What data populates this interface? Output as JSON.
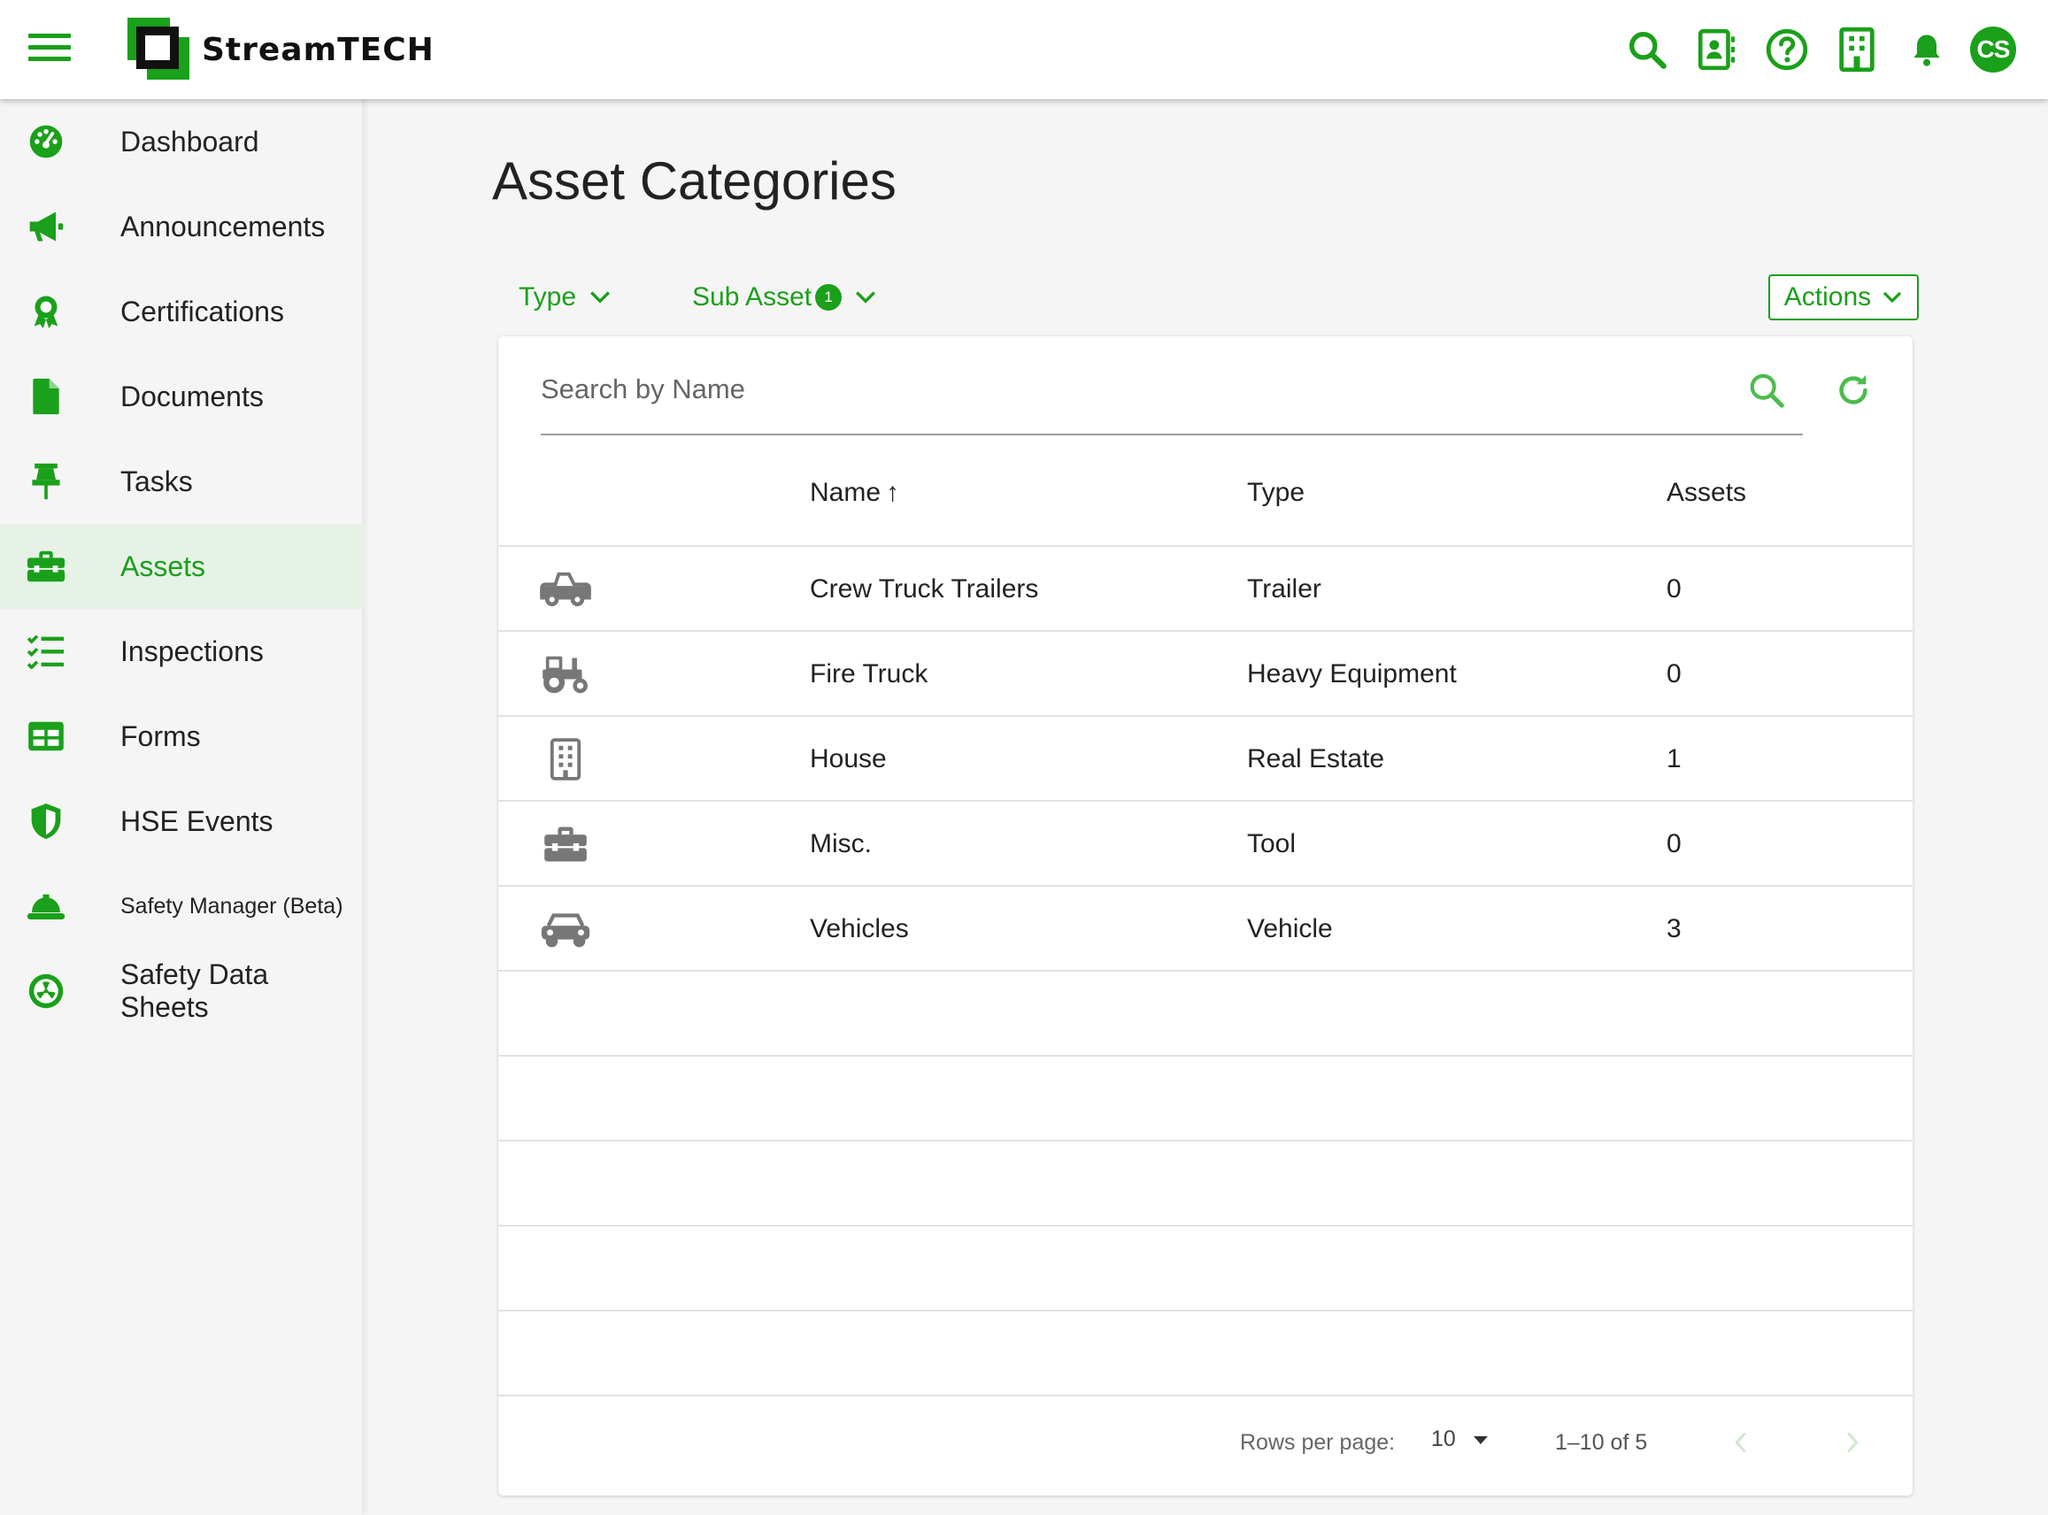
{
  "app": {
    "brand": "StreamTECH",
    "brand_color": "#1aa01a",
    "avatar_initials": "CS"
  },
  "header_icons": [
    "search-icon",
    "contact-card-icon",
    "help-icon",
    "building-icon",
    "bell-icon"
  ],
  "sidebar": {
    "active": "Assets",
    "items": [
      {
        "label": "Dashboard",
        "icon": "dashboard-icon"
      },
      {
        "label": "Announcements",
        "icon": "megaphone-icon"
      },
      {
        "label": "Certifications",
        "icon": "award-icon"
      },
      {
        "label": "Documents",
        "icon": "document-icon"
      },
      {
        "label": "Tasks",
        "icon": "pushpin-icon"
      },
      {
        "label": "Assets",
        "icon": "toolbox-icon"
      },
      {
        "label": "Inspections",
        "icon": "checklist-icon"
      },
      {
        "label": "Forms",
        "icon": "table-icon"
      },
      {
        "label": "HSE Events",
        "icon": "shield-icon"
      },
      {
        "label": "Safety Manager (Beta)",
        "icon": "hardhat-icon"
      },
      {
        "label": "Safety Data Sheets",
        "icon": "hazard-icon"
      }
    ]
  },
  "main": {
    "title": "Asset Categories",
    "filters": {
      "type_label": "Type",
      "sub_asset_label": "Sub Asset",
      "sub_asset_count": "1"
    },
    "actions_label": "Actions",
    "search": {
      "placeholder": "Search by Name"
    },
    "table": {
      "columns": {
        "name": "Name",
        "type": "Type",
        "assets": "Assets"
      },
      "sort_indicator": "↑",
      "rows": [
        {
          "icon": "trailer-icon",
          "name": "Crew Truck Trailers",
          "type": "Trailer",
          "assets": "0"
        },
        {
          "icon": "tractor-icon",
          "name": "Fire Truck",
          "type": "Heavy Equipment",
          "assets": "0"
        },
        {
          "icon": "building-icon",
          "name": "House",
          "type": "Real Estate",
          "assets": "1"
        },
        {
          "icon": "toolbox-icon",
          "name": "Misc.",
          "type": "Tool",
          "assets": "0"
        },
        {
          "icon": "car-icon",
          "name": "Vehicles",
          "type": "Vehicle",
          "assets": "3"
        }
      ]
    },
    "pagination": {
      "rows_per_page_label": "Rows per page:",
      "rows_per_page": "10",
      "range": "1–10 of 5"
    }
  }
}
